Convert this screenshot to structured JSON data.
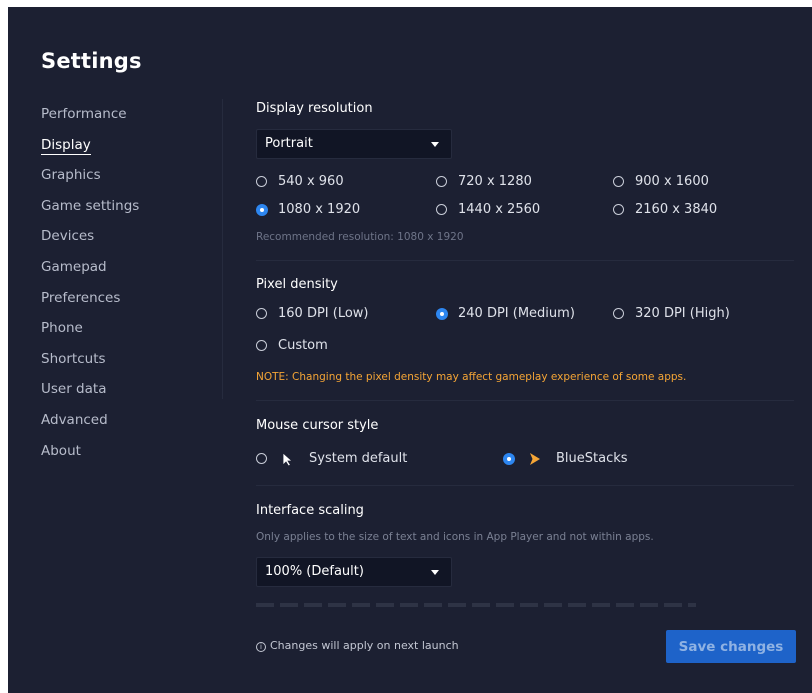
{
  "title": "Settings",
  "sidebar": {
    "items": [
      {
        "label": "Performance"
      },
      {
        "label": "Display"
      },
      {
        "label": "Graphics"
      },
      {
        "label": "Game settings"
      },
      {
        "label": "Devices"
      },
      {
        "label": "Gamepad"
      },
      {
        "label": "Preferences"
      },
      {
        "label": "Phone"
      },
      {
        "label": "Shortcuts"
      },
      {
        "label": "User data"
      },
      {
        "label": "Advanced"
      },
      {
        "label": "About"
      }
    ],
    "active": "Display"
  },
  "display_resolution": {
    "title": "Display resolution",
    "orientation": "Portrait",
    "options": [
      "540 x 960",
      "720 x 1280",
      "900 x 1600",
      "1080 x 1920",
      "1440 x 2560",
      "2160 x 3840"
    ],
    "selected": "1080 x 1920",
    "recommended": "Recommended resolution: 1080 x 1920"
  },
  "pixel_density": {
    "title": "Pixel density",
    "options": [
      "160 DPI (Low)",
      "240 DPI (Medium)",
      "320 DPI (High)",
      "Custom"
    ],
    "selected": "240 DPI (Medium)",
    "note": "NOTE: Changing the pixel density may affect gameplay experience of some apps."
  },
  "mouse_cursor": {
    "title": "Mouse cursor style",
    "options": [
      "System default",
      "BlueStacks"
    ],
    "selected": "BlueStacks"
  },
  "interface_scaling": {
    "title": "Interface scaling",
    "description": "Only applies to the size of text and icons in App Player and not within apps.",
    "value": "100% (Default)"
  },
  "footer": {
    "note": "Changes will apply on next launch",
    "save_label": "Save changes"
  },
  "colors": {
    "background": "#1c2032",
    "accent": "#2d86f0",
    "warning": "#f5a536",
    "button": "#1e63c9"
  }
}
